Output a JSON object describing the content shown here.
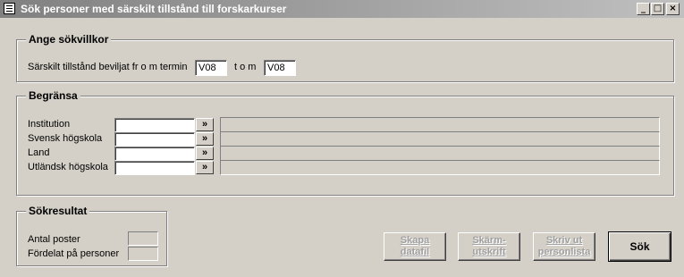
{
  "window": {
    "title": "Sök personer med särskilt tillstånd till forskarkurser",
    "min_glyph": "_",
    "max_glyph": "□",
    "close_glyph": "×"
  },
  "criteria": {
    "heading": "Ange sökvillkor",
    "term_label": "Särskilt tillstånd beviljat fr o m termin",
    "from_value": "V08",
    "to_label": "t o m",
    "to_value": "V08"
  },
  "limit": {
    "heading": "Begränsa",
    "lookup_glyph": "»",
    "rows": [
      {
        "label": "Institution",
        "value": ""
      },
      {
        "label": "Svensk högskola",
        "value": ""
      },
      {
        "label": "Land",
        "value": ""
      },
      {
        "label": "Utländsk högskola",
        "value": ""
      }
    ]
  },
  "results": {
    "heading": "Sökresultat",
    "count_label": "Antal poster",
    "count_value": "",
    "spread_label": "Fördelat på personer",
    "spread_value": ""
  },
  "actions": {
    "datafile_line1": "Skapa",
    "datafile_line2": "datafil",
    "screen_line1": "Skärm-",
    "screen_line2": "utskrift",
    "print_line1": "Skriv ut",
    "print_line2": "personlista",
    "search_label": "Sök"
  }
}
